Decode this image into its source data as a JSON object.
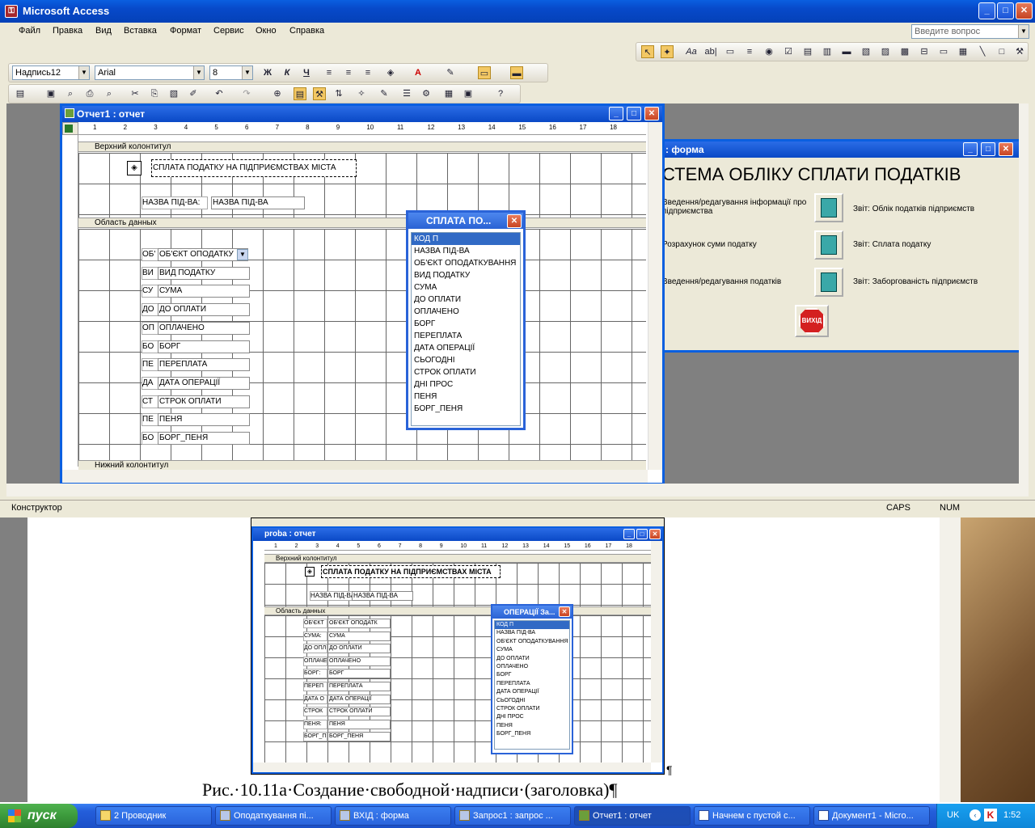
{
  "app": {
    "title": "Microsoft Access",
    "help_placeholder": "Введите вопрос"
  },
  "menu": [
    "Файл",
    "Правка",
    "Вид",
    "Вставка",
    "Формат",
    "Сервис",
    "Окно",
    "Справка"
  ],
  "format_toolbar": {
    "object": "Надпись12",
    "font": "Arial",
    "size": "8"
  },
  "report": {
    "title": "Отчет1 : отчет",
    "ruler": [
      "1",
      "2",
      "3",
      "4",
      "5",
      "6",
      "7",
      "8",
      "9",
      "10",
      "11",
      "12",
      "13",
      "14",
      "15",
      "16",
      "17",
      "18"
    ],
    "sections": {
      "header": "Верхний колонтитул",
      "detail": "Область данных",
      "footer": "Нижний колонтитул"
    },
    "heading_label": "СПЛАТА ПОДАТКУ НА ПІДПРИЄМСТВАХ МІСТА",
    "header_label": "НАЗВА ПІД-ВА:",
    "header_field": "НАЗВА ПІД-ВА",
    "detail_rows": [
      {
        "label": "ОБ'",
        "field": "ОБ'ЄКТ ОПОДАТКУ"
      },
      {
        "label": "ВИ",
        "field": "ВИД ПОДАТКУ"
      },
      {
        "label": "СУ",
        "field": "СУМА"
      },
      {
        "label": "ДО",
        "field": "ДО ОПЛАТИ"
      },
      {
        "label": "ОП",
        "field": "ОПЛАЧЕНО"
      },
      {
        "label": "БО",
        "field": "БОРГ"
      },
      {
        "label": "ПЕ",
        "field": "ПЕРЕПЛАТА"
      },
      {
        "label": "ДА",
        "field": "ДАТА ОПЕРАЦІЇ"
      },
      {
        "label": "СТ",
        "field": "СТРОК ОПЛАТИ"
      },
      {
        "label": "ПЕ",
        "field": "ПЕНЯ"
      },
      {
        "label": "БО",
        "field": "БОРГ_ПЕНЯ"
      }
    ]
  },
  "fieldlist": {
    "title": "СПЛАТА ПО...",
    "items": [
      "КОД П",
      "НАЗВА ПІД-ВА",
      "ОБ'ЄКТ ОПОДАТКУВАННЯ",
      "ВИД ПОДАТКУ",
      "СУМА",
      "ДО ОПЛАТИ",
      "ОПЛАЧЕНО",
      "БОРГ",
      "ПЕРЕПЛАТА",
      "ДАТА ОПЕРАЦІЇ",
      "СЬОГОДНІ",
      "СТРОК ОПЛАТИ",
      "ДНІ ПРОС",
      "ПЕНЯ",
      "БОРГ_ПЕНЯ"
    ]
  },
  "form": {
    "title": ": форма",
    "heading": "СТЕМА ОБЛІКУ СПЛАТИ ПОДАТКІВ",
    "rows": [
      {
        "left": "Введення/редагування інформації про підприємства",
        "right": "Звіт: Облік податків підприємств"
      },
      {
        "left": "Розрахунок суми податку",
        "right": "Звіт: Сплата податку"
      },
      {
        "left": "Введення/редагування податків",
        "right": "Звіт: Заборгованість підприємств"
      }
    ],
    "exit": "ВИХІД"
  },
  "status": {
    "mode": "Конструктор",
    "caps": "CAPS",
    "num": "NUM"
  },
  "doc_report": {
    "title": "proba : отчет",
    "heading_label": "СПЛАТА ПОДАТКУ НА ПІДПРИЄМСТВАХ МІСТА",
    "sections": {
      "header": "Верхний колонтитул",
      "detail": "Область данных"
    },
    "header_label": "НАЗВА ПІД-ВА",
    "header_field": "НАЗВА ПІД-ВА",
    "rows": [
      {
        "label": "ОБ'ЄКТ",
        "field": "ОБ'ЄКТ ОПОДАТК"
      },
      {
        "label": "СУМА:",
        "field": "СУМА"
      },
      {
        "label": "ДО ОПЛ",
        "field": "ДО ОПЛАТИ"
      },
      {
        "label": "ОПЛАЧЕ",
        "field": "ОПЛАЧЕНО"
      },
      {
        "label": "БОРГ:",
        "field": "БОРГ"
      },
      {
        "label": "ПЕРЕП",
        "field": "ПЕРЕПЛАТА"
      },
      {
        "label": "ДАТА О",
        "field": "ДАТА ОПЕРАЦІЇ"
      },
      {
        "label": "СТРОК",
        "field": "СТРОК ОПЛАТИ"
      },
      {
        "label": "ПЕНЯ:",
        "field": "ПЕНЯ"
      },
      {
        "label": "БОРГ_П",
        "field": "БОРГ_ПЕНЯ"
      }
    ],
    "fieldlist_title": "ОПЕРАЦІЇ За...",
    "fieldlist_items": [
      "КОД П",
      "НАЗВА ПІД-ВА",
      "ОБ'ЄКТ ОПОДАТКУВАННЯ",
      "СУМА",
      "ДО ОПЛАТИ",
      "ОПЛАЧЕНО",
      "БОРГ",
      "ПЕРЕПЛАТА",
      "ДАТА ОПЕРАЦІЇ",
      "СЬОГОДНІ",
      "СТРОК ОПЛАТИ",
      "ДНІ ПРОС",
      "ПЕНЯ",
      "БОРГ_ПЕНЯ"
    ]
  },
  "caption": "Рис.·10.11а·Создание·свободной·надписи·(заголовка)¶",
  "para_mark": "¶",
  "taskbar": {
    "start": "пуск",
    "tasks": [
      "2 Проводник",
      "Оподаткування пі...",
      "ВХІД : форма",
      "Запрос1 : запрос ...",
      "Отчет1 : отчет",
      "Начнем с пустой с...",
      "Документ1 - Micro..."
    ],
    "lang": "UK",
    "clock": "1:52"
  },
  "colors": {
    "xp_blue": "#0a5fe0",
    "selection": "#316ac5",
    "taskbar": "#245edb",
    "start": "#3c9a3c"
  }
}
